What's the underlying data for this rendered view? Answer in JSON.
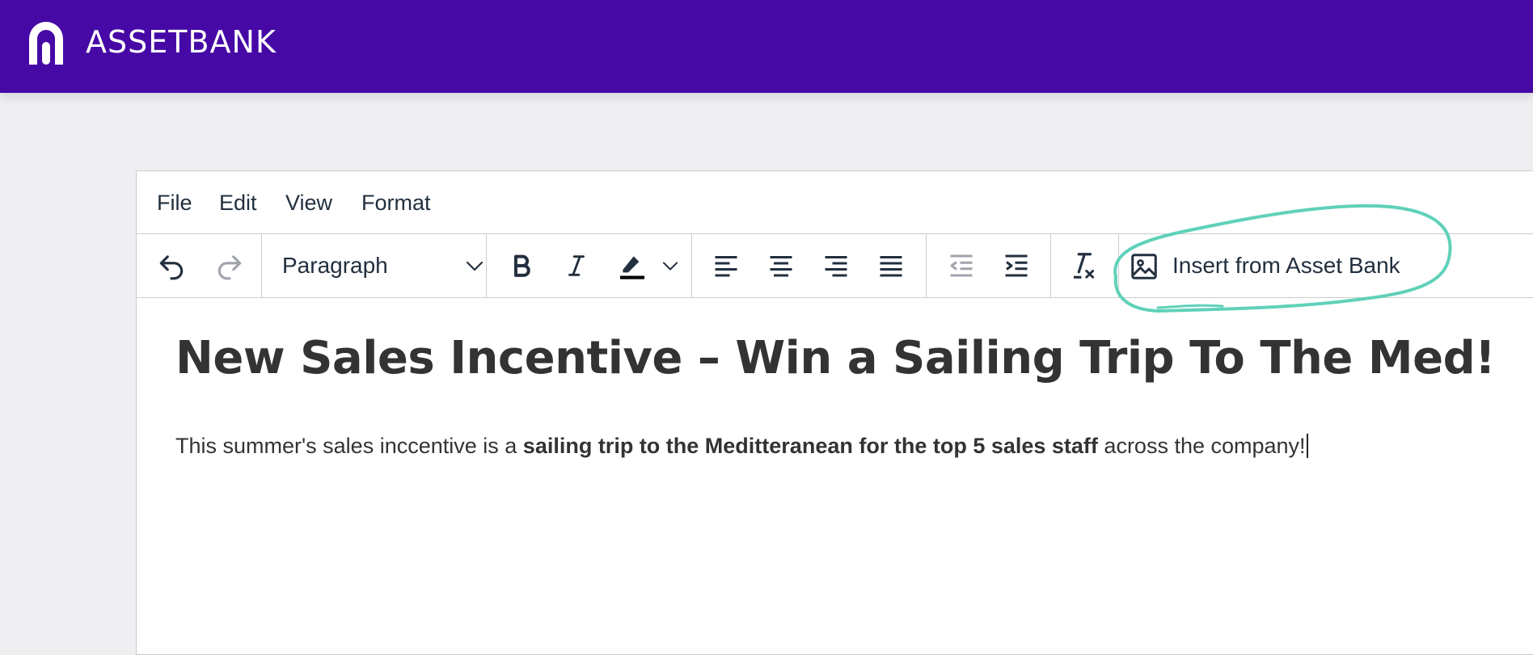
{
  "app": {
    "brand_name": "ASSETBANK",
    "brand_color": "#4609a6",
    "logo_icon": "assetbank-logo-icon"
  },
  "menubar": {
    "items": [
      "File",
      "Edit",
      "View",
      "Format"
    ]
  },
  "toolbar": {
    "undo_icon": "undo-icon",
    "redo_icon": "redo-icon",
    "block_format": {
      "selected": "Paragraph",
      "icon": "chevron-down-icon"
    },
    "bold_icon": "bold-icon",
    "italic_icon": "italic-icon",
    "highlight_icon": "highlight-color-icon",
    "align_left_icon": "align-left-icon",
    "align_center_icon": "align-center-icon",
    "align_right_icon": "align-right-icon",
    "justify_icon": "align-justify-icon",
    "outdent_icon": "outdent-icon",
    "indent_icon": "indent-icon",
    "clear_format_icon": "clear-formatting-icon",
    "insert_asset": {
      "label": "Insert from Asset Bank",
      "icon": "image-icon"
    },
    "annotation_color": "#5fd1b9"
  },
  "document": {
    "title": "New Sales Incentive – Win a Sailing Trip To The Med!",
    "paragraph": {
      "before": "This summer's sales inccentive is a ",
      "bold": "sailing trip to the Meditteranean for the top 5 sales staff",
      "after": " across the company!"
    }
  }
}
